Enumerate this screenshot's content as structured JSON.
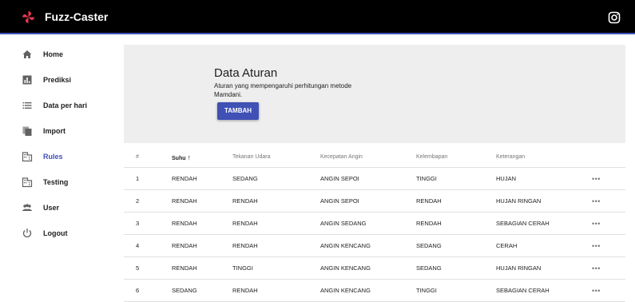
{
  "app": {
    "title": "Fuzz-Caster",
    "instagram_icon": "instagram-icon",
    "logo_icon": "pinwheel-logo-icon",
    "accent_color": "#3f51b5",
    "logo_color": "#e53950"
  },
  "sidebar": {
    "items": [
      {
        "label": "Home",
        "icon": "home-icon"
      },
      {
        "label": "Prediksi",
        "icon": "bar-chart-icon"
      },
      {
        "label": "Data per hari",
        "icon": "list-icon"
      },
      {
        "label": "Import",
        "icon": "import-file-icon"
      },
      {
        "label": "Rules",
        "icon": "building-icon",
        "active": true
      },
      {
        "label": "Testing",
        "icon": "building-icon"
      },
      {
        "label": "User",
        "icon": "users-icon"
      },
      {
        "label": "Logout",
        "icon": "power-icon"
      }
    ]
  },
  "header": {
    "title": "Data Aturan",
    "description": "Aturan yang mempengaruhi perhitungan metode Mamdani.",
    "add_button": "TAMBAH"
  },
  "table": {
    "columns": [
      "#",
      "Suhu",
      "Tekanan Udara",
      "Kecepatan Angin",
      "Kelembapan",
      "Keterangan"
    ],
    "sort_indicator": "↑",
    "row_menu": "•••",
    "rows": [
      [
        "1",
        "RENDAH",
        "SEDANG",
        "ANGIN SEPOI",
        "TINGGI",
        "HUJAN"
      ],
      [
        "2",
        "RENDAH",
        "RENDAH",
        "ANGIN SEPOI",
        "RENDAH",
        "HUJAN RINGAN"
      ],
      [
        "3",
        "RENDAH",
        "RENDAH",
        "ANGIN SEDANG",
        "RENDAH",
        "SEBAGIAN CERAH"
      ],
      [
        "4",
        "RENDAH",
        "RENDAH",
        "ANGIN KENCANG",
        "SEDANG",
        "CERAH"
      ],
      [
        "5",
        "RENDAH",
        "TINGGI",
        "ANGIN KENCANG",
        "SEDANG",
        "HUJAN RINGAN"
      ],
      [
        "6",
        "SEDANG",
        "RENDAH",
        "ANGIN KENCANG",
        "TINGGI",
        "SEBAGIAN CERAH"
      ]
    ]
  }
}
